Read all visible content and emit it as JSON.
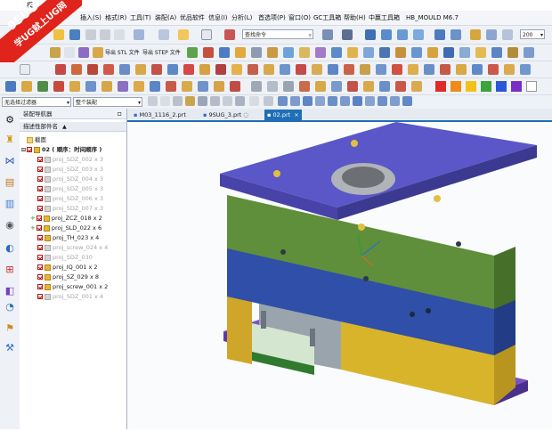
{
  "window": {
    "title": "模"
  },
  "watermark": {
    "line1": "9SUG",
    "line2": "学UG就上UG网"
  },
  "menu": {
    "items": [
      "插入(S)",
      "格式(R)",
      "工具(T)",
      "装配(A)",
      "优品软件",
      "信息(I)",
      "分析(L)",
      "首选项(P)",
      "窗口(O)",
      "GC工具箱",
      "帮助(H)",
      "中赢工具箱",
      "HB_MOULD M6.7"
    ]
  },
  "toolbar": {
    "search_placeholder": "查找命令",
    "zoom_value": "200",
    "export_stl": "导出 STL 文件",
    "export_step": "导出 STEP 文件",
    "filter_value": "无选择过滤器",
    "assembly_scope": "整个装配"
  },
  "navigator": {
    "title": "装配导航器",
    "column_header": "描述性部件名",
    "section_label": "截面",
    "root_label": "02 ( 顺序：时间顺序 )",
    "items": [
      {
        "label": "proj_SDZ_002 x 3",
        "checked": true,
        "dim": true
      },
      {
        "label": "proj_SDZ_003 x 3",
        "checked": true,
        "dim": true
      },
      {
        "label": "proj_SDZ_004 x 3",
        "checked": true,
        "dim": true
      },
      {
        "label": "proj_SDZ_005 x 3",
        "checked": true,
        "dim": true
      },
      {
        "label": "proj_SDZ_006 x 3",
        "checked": true,
        "dim": true
      },
      {
        "label": "proj_SDZ_007 x 3",
        "checked": true,
        "dim": true
      },
      {
        "label": "proj_ZCZ_018 x 2",
        "checked": true,
        "dim": false,
        "expandable": true
      },
      {
        "label": "proj_SLD_022 x 6",
        "checked": true,
        "dim": false,
        "expandable": true
      },
      {
        "label": "proj_TH_023 x 4",
        "checked": true,
        "dim": false
      },
      {
        "label": "proj_screw_024 x 4",
        "checked": true,
        "dim": true
      },
      {
        "label": "proj_SDZ_030",
        "checked": true,
        "dim": true
      },
      {
        "label": "proj_IQ_001 x 2",
        "checked": true,
        "dim": false
      },
      {
        "label": "proj_SZ_029 x 8",
        "checked": true,
        "dim": false
      },
      {
        "label": "proj_screw_001 x 2",
        "checked": true,
        "dim": false
      },
      {
        "label": "proj_SDZ_001 x 4",
        "checked": true,
        "dim": true
      }
    ]
  },
  "tabs": [
    {
      "label": "M03_1116_2.prt",
      "active": false
    },
    {
      "label": "9SUG_3.prt",
      "active": false
    },
    {
      "label": "02.prt",
      "active": true
    }
  ],
  "colors": {
    "plate_top": "#5b57c9",
    "plate_green": "#5f8f3a",
    "plate_blue": "#2f4fa8",
    "plate_yellow": "#d8b42a",
    "plate_base": "#6a3fb8",
    "accent": "#1f6fb8"
  }
}
